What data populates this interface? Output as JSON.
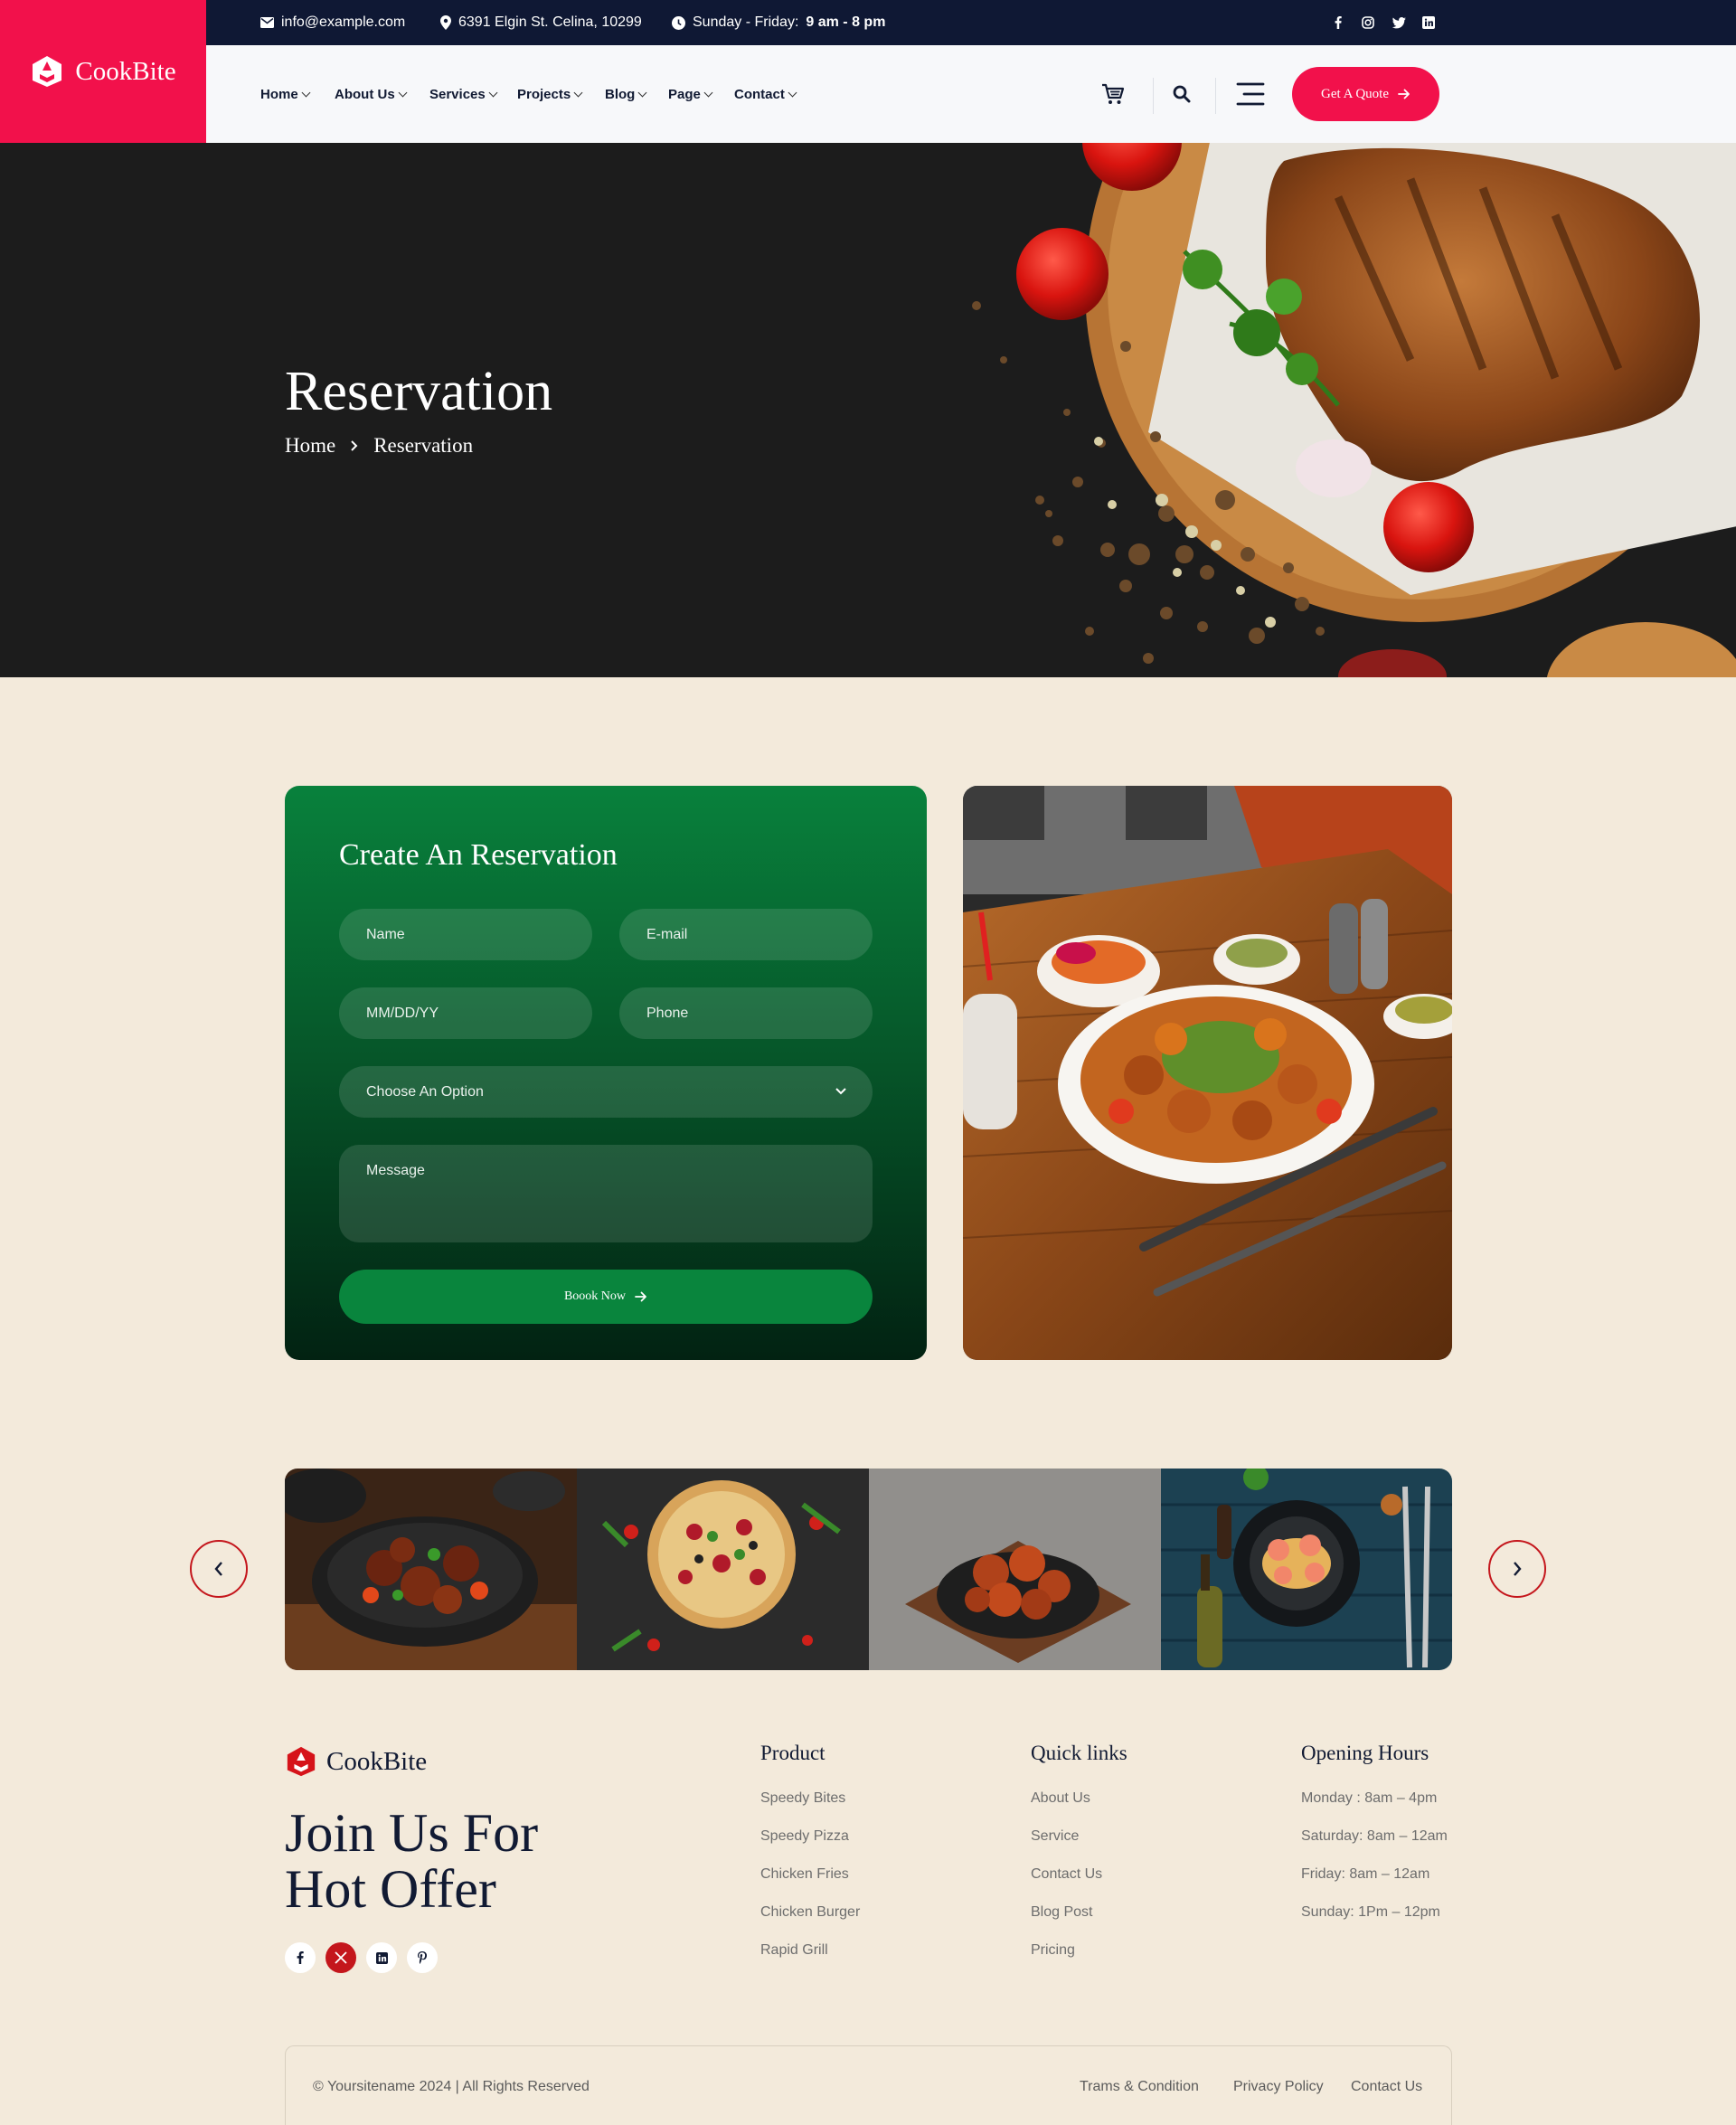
{
  "brand": {
    "name": "CookBite"
  },
  "topbar": {
    "email": "info@example.com",
    "address": "6391 Elgin St. Celina, 10299",
    "hours_label": "Sunday - Friday:",
    "hours_value": "9 am - 8 pm",
    "social": [
      "facebook-icon",
      "instagram-icon",
      "twitter-icon",
      "linkedin-icon"
    ]
  },
  "nav": {
    "items": [
      "Home",
      "About Us",
      "Services",
      "Projects",
      "Blog",
      "Page",
      "Contact"
    ],
    "quote_label": "Get A Quote"
  },
  "hero": {
    "title": "Reservation",
    "breadcrumb": [
      "Home",
      "Reservation"
    ]
  },
  "form": {
    "title": "Create An Reservation",
    "name_placeholder": "Name",
    "email_placeholder": "E-mail",
    "date_placeholder": "MM/DD/YY",
    "phone_placeholder": "Phone",
    "select_value": "Choose An Option",
    "message_placeholder": "Message",
    "submit_label": "Boook Now"
  },
  "gallery": {
    "items": [
      "beef-stew-image",
      "pizza-image",
      "chicken-wings-image",
      "shrimp-pasta-image"
    ]
  },
  "footer": {
    "brand": "CookBite",
    "headline_line1": "Join Us For",
    "headline_line2": "Hot Offer",
    "columns": [
      {
        "title": "Product",
        "items": [
          "Speedy Bites",
          "Speedy Pizza",
          "Chicken Fries",
          "Chicken Burger",
          "Rapid Grill"
        ]
      },
      {
        "title": "Quick links",
        "items": [
          "About Us",
          "Service",
          "Contact Us",
          "Blog Post",
          "Pricing"
        ]
      },
      {
        "title": "Opening Hours",
        "items": [
          "Monday : 8am – 4pm",
          "Saturday: 8am – 12am",
          "Friday: 8am – 12am",
          "Sunday: 1Pm – 12pm"
        ]
      }
    ],
    "copyright": "© Yoursitename  2024 | All Rights Reserved",
    "links": [
      "Trams & Condition",
      "Privacy Policy",
      "Contact Us"
    ]
  },
  "colors": {
    "accent": "#f2114b",
    "navy": "#0f1834",
    "green": "#08813c",
    "cream": "#f3eadb"
  }
}
